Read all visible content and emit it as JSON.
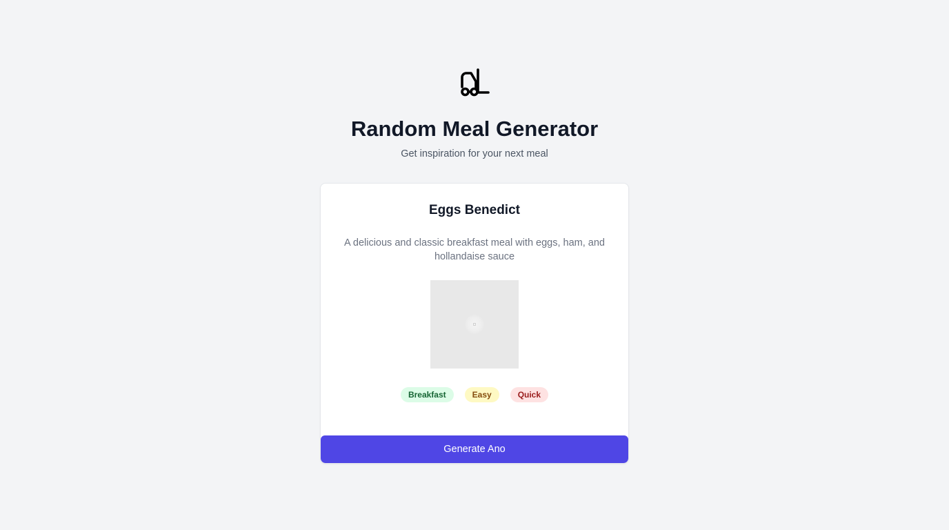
{
  "app": {
    "logo_icon": "forklift-icon",
    "title": "Random Meal Generator",
    "subtitle": "Get inspiration for your next meal"
  },
  "meal": {
    "name": "Eggs Benedict",
    "description": "A delicious and classic breakfast meal with eggs, ham, and hollandaise sauce",
    "image_icon": "loading-spinner-icon",
    "tags": [
      {
        "label": "Breakfast",
        "color": "#dcfce7",
        "text_color": "#166534"
      },
      {
        "label": "Easy",
        "color": "#fef9c3",
        "text_color": "#854d0e"
      },
      {
        "label": "Quick",
        "color": "#fee2e2",
        "text_color": "#991b1b"
      }
    ]
  },
  "actions": {
    "generate_label": "Generate Ano"
  },
  "colors": {
    "background": "#f3f4f6",
    "accent": "#4f46e5",
    "title": "#111827",
    "muted": "#6b7280"
  }
}
